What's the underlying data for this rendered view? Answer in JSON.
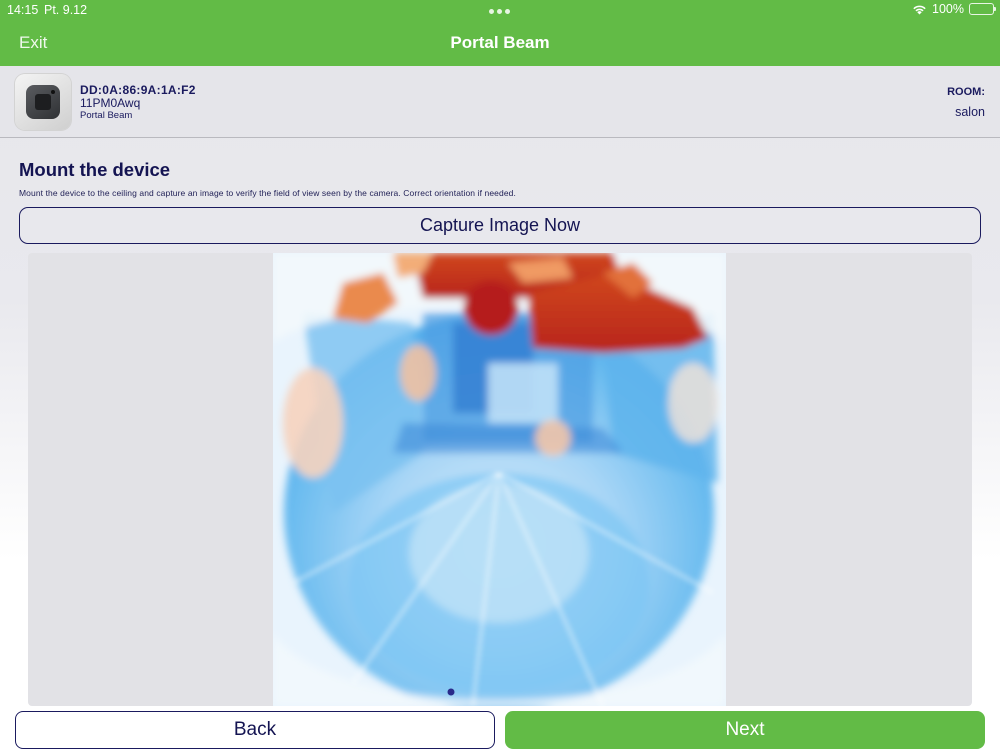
{
  "status_bar": {
    "time": "14:15",
    "date": "Pt. 9.12",
    "battery_percent": "100%"
  },
  "nav": {
    "exit_label": "Exit",
    "title": "Portal Beam"
  },
  "device": {
    "mac": "DD:0A:86:9A:1A:F2",
    "serial": "11PM0Awq",
    "model": "Portal Beam",
    "room_label": "ROOM:",
    "room_value": "salon",
    "thumbnail_icon": "portal-beam-device-icon"
  },
  "section": {
    "title": "Mount the device",
    "description": "Mount the device to the ceiling and capture an image to verify the field of view seen by the camera. Correct orientation if needed."
  },
  "capture_label": "Capture Image Now",
  "footer": {
    "back_label": "Back",
    "next_label": "Next"
  },
  "colors": {
    "brand_green": "#62bb46",
    "navy_text": "#1a1a5e",
    "thermal_hot": "#c0231d",
    "thermal_cold": "#3a8fd9"
  }
}
